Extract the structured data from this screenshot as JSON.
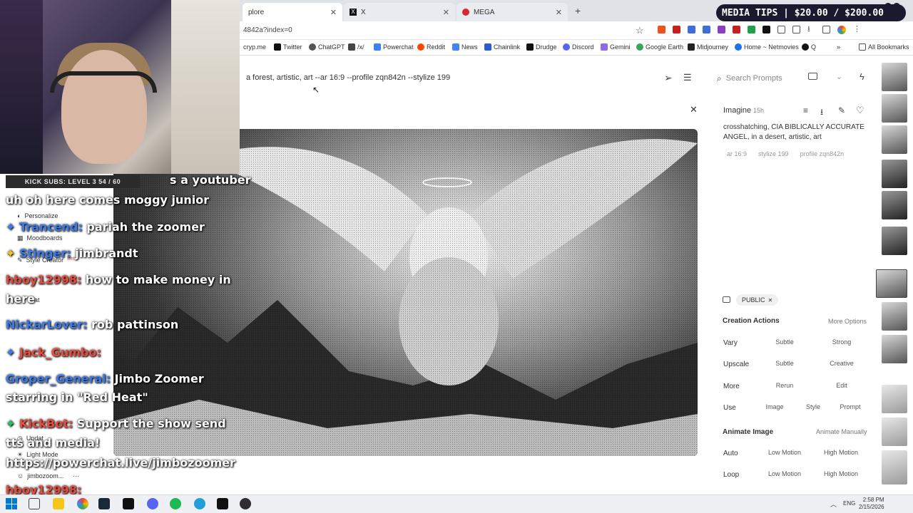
{
  "browser": {
    "tabs": [
      {
        "label": "plore",
        "icon": "midjourney-icon"
      },
      {
        "label": "X",
        "icon": "x-icon"
      },
      {
        "label": "MEGA",
        "icon": "mega-icon"
      }
    ],
    "url": "4842a?index=0",
    "bookmarks": [
      {
        "label": "cryp.me",
        "color": "#888888"
      },
      {
        "label": "Twitter",
        "color": "#111111"
      },
      {
        "label": "ChatGPT",
        "color": "#444444"
      },
      {
        "label": "/x/",
        "color": "#333333"
      },
      {
        "label": "Powerchat",
        "color": "#3b82f6"
      },
      {
        "label": "Reddit",
        "color": "#ff4500"
      },
      {
        "label": "News",
        "color": "#4285f4"
      },
      {
        "label": "Chainlink",
        "color": "#2a5ada"
      },
      {
        "label": "Drudge",
        "color": "#111111"
      },
      {
        "label": "Discord",
        "color": "#5865f2"
      },
      {
        "label": "Gemini",
        "color": "#8e6ce8"
      },
      {
        "label": "Google Earth",
        "color": "#34a853"
      },
      {
        "label": "Midjourney",
        "color": "#222222"
      },
      {
        "label": "Home ~ Netmovies",
        "color": "#1a73e8"
      },
      {
        "label": "Q",
        "color": "#111111"
      }
    ],
    "all_bookmarks": "All Bookmarks"
  },
  "prompt": {
    "text": "a forest, artistic, art --ar 16:9 --profile zqn842n --stylize 199"
  },
  "search": {
    "placeholder": "Search Prompts"
  },
  "detail": {
    "mode": "Imagine",
    "age": "15h",
    "prompt": "crosshatching, CIA BIBLICALLY ACCURATE ANGEL, in a desert, artistic, art",
    "tags": [
      "ar 16:9",
      "stylize 199",
      "profile zqn842n"
    ],
    "visibility": "PUBLIC",
    "creation_actions": "Creation Actions",
    "more_options": "More Options",
    "rows": [
      {
        "label": "Vary",
        "a": "Subtle",
        "b": "Strong"
      },
      {
        "label": "Upscale",
        "a": "Subtle",
        "b": "Creative"
      },
      {
        "label": "More",
        "a": "Rerun",
        "b": "Edit"
      }
    ],
    "use_row": {
      "label": "Use",
      "a": "Image",
      "b": "Style",
      "c": "Prompt"
    },
    "animate_title": "Animate Image",
    "animate_manual": "Animate Manually",
    "animate_rows": [
      {
        "label": "Auto",
        "a": "Low Motion",
        "b": "High Motion"
      },
      {
        "label": "Loop",
        "a": "Low Motion",
        "b": "High Motion"
      }
    ]
  },
  "overlay": {
    "media_tips": "MEDIA TIPS | $20.00 / $200.00",
    "kick_subs": "KICK SUBS: LEVEL 3 54 / 60"
  },
  "sidebar": {
    "items": [
      "Personalize",
      "Moodboards",
      "Style Creator",
      "Beta",
      "at",
      "Updat",
      "Light Mode",
      "jimbozoom..."
    ]
  },
  "chat": [
    {
      "user": "",
      "msg": "s a youtuber"
    },
    {
      "user": "",
      "msg": "uh oh here comes moggy junior"
    },
    {
      "user": "Trancend:",
      "msg": "pariah the zoomer"
    },
    {
      "user": "Stinger:",
      "msg": "jimbrandt"
    },
    {
      "user": "hboy12998:",
      "msg": "how to make money in"
    },
    {
      "user": "",
      "msg": "here"
    },
    {
      "user": "NickarLover:",
      "msg": "rob pattinson"
    },
    {
      "user": "Jack_Gumbo:",
      "msg": ""
    },
    {
      "user": "Groper_General:",
      "msg": "Jimbo Zoomer"
    },
    {
      "user": "",
      "msg": "starring in \"Red Heat\""
    },
    {
      "user": "KickBot:",
      "msg": "Support the show send"
    },
    {
      "user": "",
      "msg": "tts and media!"
    },
    {
      "user": "",
      "msg": "https://powerchat.live/jimbozoomer"
    },
    {
      "user": "hboy12998:",
      "msg": ""
    }
  ],
  "taskbar": {
    "lang": "ENG",
    "time": "2:58 PM",
    "date": "2/15/2026"
  }
}
